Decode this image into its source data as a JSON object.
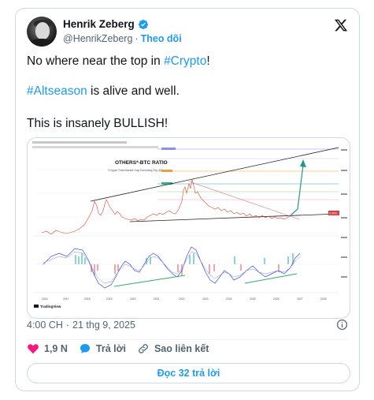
{
  "author": {
    "name": "Henrik Zeberg",
    "handle": "@HenrikZeberg",
    "separator": "·",
    "follow_label": "Theo dõi"
  },
  "tweet": {
    "line1_prefix": "No where near the top in ",
    "line1_hashtag": "#Crypto",
    "line1_suffix": "!",
    "line2_hashtag": "#Altseason",
    "line2_suffix": " is alive and well.",
    "line3": "This is insanely BULLISH!"
  },
  "chart": {
    "title": "OTHERS*-BTC RATIO",
    "subtitle": "*Crypto Total Market Cap Excluding Top 10",
    "watermark": "TradingView",
    "x_ticks": [
      "2016",
      "2017",
      "2018",
      "2019",
      "2020",
      "2021",
      "2022",
      "2023",
      "2024",
      "2025",
      "2026",
      "2027",
      "2028"
    ],
    "price_tag": "0.0400"
  },
  "meta": {
    "time": "4:00 CH",
    "date_separator": "·",
    "date": "21 thg 9, 2025"
  },
  "actions": {
    "likes": "1,9 N",
    "reply": "Trả lời",
    "copy_link": "Sao liên kết"
  },
  "read_replies": "Đọc 32 trả lời",
  "colors": {
    "accent": "#1d9bf0",
    "like": "#f91880",
    "text_secondary": "#536471",
    "border": "#cfd9de"
  },
  "icons": [
    "verified-badge-icon",
    "x-logo-icon",
    "info-icon",
    "heart-icon",
    "reply-bubble-icon",
    "link-icon"
  ]
}
